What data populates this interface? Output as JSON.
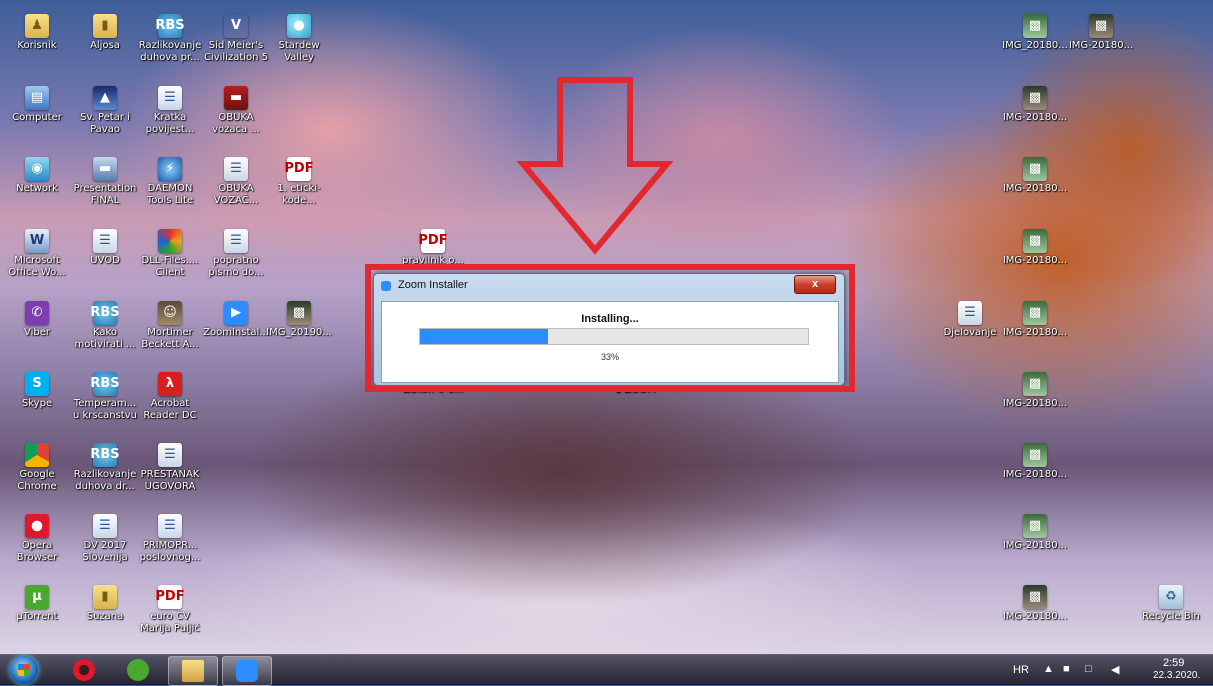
{
  "desktop": {
    "icons": [
      {
        "label": "Korisnik",
        "icon": "user-folder-icon"
      },
      {
        "label": "Aljosa",
        "icon": "folder-icon"
      },
      {
        "label": "Razlikovanje duhova pr...",
        "icon": "rbs-icon"
      },
      {
        "label": "Sid Meier's Civilization 5",
        "icon": "civilization-icon"
      },
      {
        "label": "Stardew Valley",
        "icon": "stardew-icon"
      },
      {
        "label": "Computer",
        "icon": "computer-icon"
      },
      {
        "label": "Sv. Petar i Pavao",
        "icon": "image-icon"
      },
      {
        "label": "Kratka povijest...",
        "icon": "document-icon"
      },
      {
        "label": "OBUKA vozaca ...",
        "icon": "video-icon"
      },
      {
        "label": "Network",
        "icon": "network-icon"
      },
      {
        "label": "Presentation FINAL",
        "icon": "presentation-icon"
      },
      {
        "label": "DAEMON Tools Lite",
        "icon": "daemon-tools-icon"
      },
      {
        "label": "OBUKA VOZAČ...",
        "icon": "document-icon"
      },
      {
        "label": "1. eticki-kode...",
        "icon": "pdf-icon"
      },
      {
        "label": "Microsoft Office Wo...",
        "icon": "word-icon"
      },
      {
        "label": "UVOD",
        "icon": "document-icon"
      },
      {
        "label": "DLL-Files.... Client",
        "icon": "dll-files-icon"
      },
      {
        "label": "popratno pismo do...",
        "icon": "document-icon"
      },
      {
        "label": "pravilnik o...",
        "icon": "pdf-icon"
      },
      {
        "label": "Viber",
        "icon": "viber-icon"
      },
      {
        "label": "Kako motivirati ...",
        "icon": "rbs-icon"
      },
      {
        "label": "Mortimer Beckett A...",
        "icon": "game-icon"
      },
      {
        "label": "ZoomInstal...",
        "icon": "zoom-icon"
      },
      {
        "label": "IMG_20190...",
        "icon": "image-icon"
      },
      {
        "label": "Skype",
        "icon": "skype-icon"
      },
      {
        "label": "Temperam... u krscanstvu",
        "icon": "rbs-icon"
      },
      {
        "label": "Acrobat Reader DC",
        "icon": "acrobat-icon"
      },
      {
        "label": "Zakon-o-o...",
        "icon": "pdf-icon"
      },
      {
        "label": "1 ZOOM",
        "icon": "document-icon"
      },
      {
        "label": "Google Chrome",
        "icon": "chrome-icon"
      },
      {
        "label": "Razlikovanje duhova dr...",
        "icon": "rbs-icon"
      },
      {
        "label": "PRESTANAK UGOVORA",
        "icon": "document-icon"
      },
      {
        "label": "Opera Browser",
        "icon": "opera-icon"
      },
      {
        "label": "DV 2017 Slovenija",
        "icon": "document-icon"
      },
      {
        "label": "PRIMOPR... poslovnog...",
        "icon": "document-icon"
      },
      {
        "label": "µTorrent",
        "icon": "utorrent-icon"
      },
      {
        "label": "Suzana",
        "icon": "folder-icon"
      },
      {
        "label": "euro CV Marija Puljić",
        "icon": "pdf-icon"
      },
      {
        "label": "IMG_20180...",
        "icon": "image-icon"
      },
      {
        "label": "IMG-20180...",
        "icon": "image-icon"
      },
      {
        "label": "IMG-20180...",
        "icon": "image-icon"
      },
      {
        "label": "IMG-20180...",
        "icon": "image-icon"
      },
      {
        "label": "IMG-20180...",
        "icon": "image-icon"
      },
      {
        "label": "Djelovanje",
        "icon": "document-icon"
      },
      {
        "label": "IMG-20180...",
        "icon": "image-icon"
      },
      {
        "label": "IMG-20180...",
        "icon": "image-icon"
      },
      {
        "label": "IMG-20180...",
        "icon": "image-icon"
      },
      {
        "label": "IMG-20180...",
        "icon": "image-icon"
      },
      {
        "label": "IMG-20180...",
        "icon": "image-icon"
      },
      {
        "label": "Recycle Bin",
        "icon": "recycle-bin-icon"
      }
    ]
  },
  "installer": {
    "title": "Zoom Installer",
    "close_label": "x",
    "status": "Installing...",
    "progress": 0.33,
    "percent_text": "33%"
  },
  "annotation": {
    "color": "#e0282e"
  },
  "taskbar": {
    "pinned": [
      "windows-start-icon",
      "opera-icon",
      "utorrent-icon",
      "explorer-icon",
      "zoom-icon"
    ],
    "tray": {
      "language": "HR",
      "time": "2:59",
      "date": "22.3.2020."
    }
  },
  "colors": {
    "zoom_blue": "#2d8cff",
    "highlight_red": "#e0282e"
  }
}
